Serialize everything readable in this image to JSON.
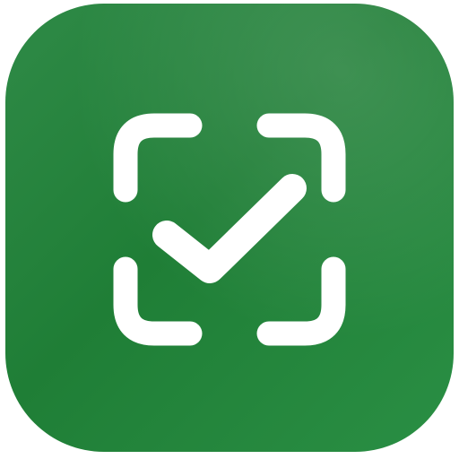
{
  "icon": {
    "name": "scan-check-icon",
    "colors": {
      "background_top": "#3a8a4e",
      "background_bottom": "#258a3e",
      "glyph": "#ffffff"
    }
  }
}
